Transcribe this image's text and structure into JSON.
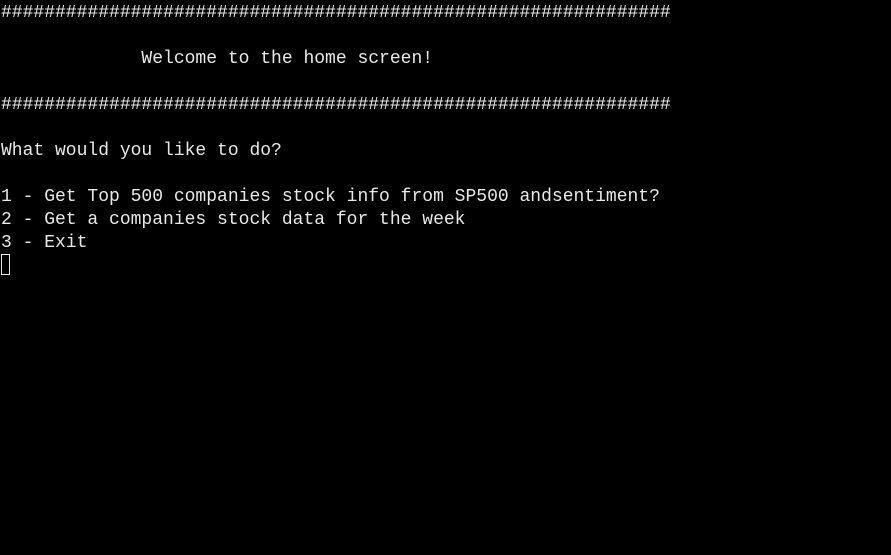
{
  "terminal": {
    "border_top": "##############################################################",
    "welcome": "             Welcome to the home screen!",
    "border_bottom": "##############################################################",
    "prompt": "What would you like to do?",
    "options": [
      "1 - Get Top 500 companies stock info from SP500 andsentiment?",
      "2 - Get a companies stock data for the week",
      "3 - Exit"
    ],
    "colors": {
      "background": "#000000",
      "text": "#e8e8e8"
    }
  }
}
